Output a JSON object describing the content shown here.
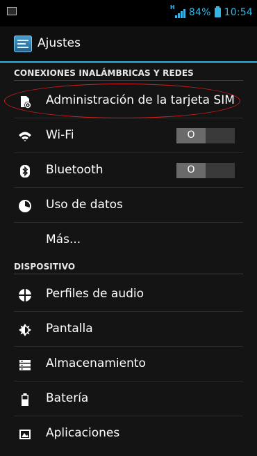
{
  "status_bar": {
    "signal_label": "H",
    "battery": "84%",
    "time": "10:54",
    "accent_color": "#33b5e5"
  },
  "action_bar": {
    "title": "Ajustes",
    "icon": "settings-app-icon"
  },
  "sections": {
    "wireless": "CONEXIONES INALÁMBRICAS Y REDES",
    "device": "DISPOSITIVO"
  },
  "items": {
    "sim": {
      "label": "Administración de la tarjeta SIM",
      "icon": "sim-settings-icon"
    },
    "wifi": {
      "label": "Wi-Fi",
      "icon": "wifi-icon",
      "toggle": "O"
    },
    "bluetooth": {
      "label": "Bluetooth",
      "icon": "bluetooth-icon",
      "toggle": "O"
    },
    "data": {
      "label": "Uso de datos",
      "icon": "data-usage-icon"
    },
    "more": {
      "label": "Más..."
    },
    "audio": {
      "label": "Perfiles de audio",
      "icon": "audio-profiles-icon"
    },
    "display": {
      "label": "Pantalla",
      "icon": "display-icon"
    },
    "storage": {
      "label": "Almacenamiento",
      "icon": "storage-icon"
    },
    "battery": {
      "label": "Batería",
      "icon": "battery-icon"
    },
    "apps": {
      "label": "Aplicaciones",
      "icon": "apps-icon"
    }
  },
  "annotation_color": "#d41d1d"
}
